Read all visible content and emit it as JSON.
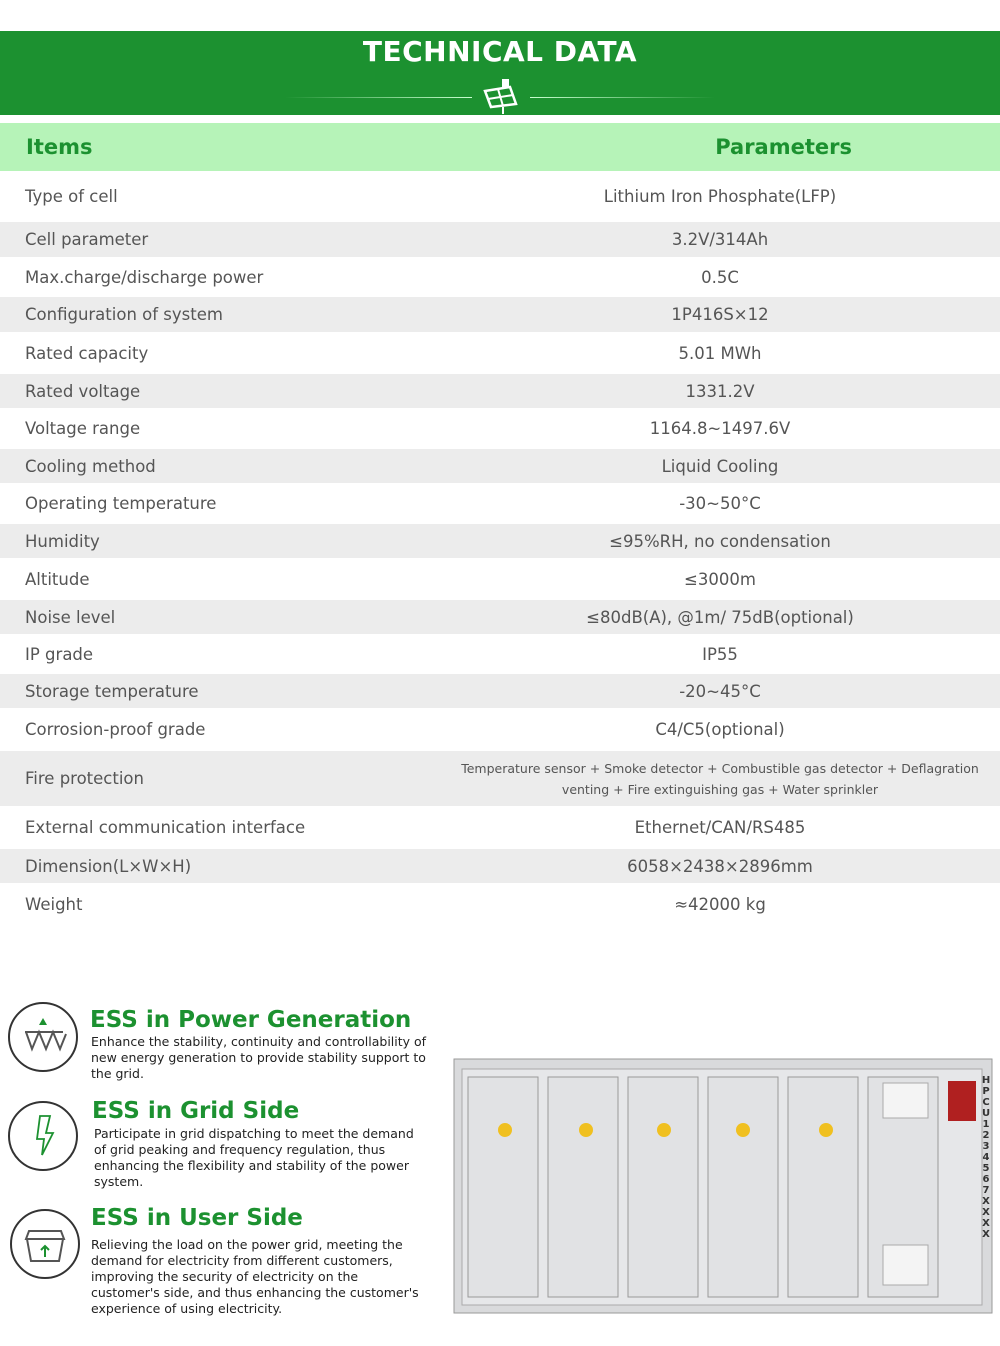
{
  "header": {
    "title": "TECHNICAL DATA"
  },
  "table": {
    "col_items": "Items",
    "col_params": "Parameters",
    "rows": [
      {
        "item": "Type of cell",
        "value": "Lithium Iron Phosphate(LFP)"
      },
      {
        "item": "Cell parameter",
        "value": "3.2V/314Ah"
      },
      {
        "item": "Max.charge/discharge power",
        "value": "0.5C"
      },
      {
        "item": "Configuration of system",
        "value": "1P416S×12"
      },
      {
        "item": "Rated capacity",
        "value": "5.01 MWh"
      },
      {
        "item": "Rated voltage",
        "value": "1331.2V"
      },
      {
        "item": "Voltage range",
        "value": "1164.8~1497.6V"
      },
      {
        "item": "Cooling method",
        "value": "Liquid Cooling"
      },
      {
        "item": "Operating temperature",
        "value": "-30~50°C"
      },
      {
        "item": "Humidity",
        "value": "≤95%RH, no condensation"
      },
      {
        "item": "Altitude",
        "value": "≤3000m"
      },
      {
        "item": "Noise level",
        "value": "≤80dB(A), @1m/ 75dB(optional)"
      },
      {
        "item": "IP grade",
        "value": "IP55"
      },
      {
        "item": "Storage temperature",
        "value": "-20~45°C"
      },
      {
        "item": "Corrosion-proof grade",
        "value": "C4/C5(optional)"
      },
      {
        "item": "Fire protection",
        "value": "Temperature sensor + Smoke detector + Combustible gas detector + Deflagration venting + Fire extinguishing gas + Water sprinkler"
      },
      {
        "item": "External communication interface",
        "value": "Ethernet/CAN/RS485"
      },
      {
        "item": "Dimension(L×W×H)",
        "value": "6058×2438×2896mm"
      },
      {
        "item": "Weight",
        "value": "≈42000 kg"
      }
    ]
  },
  "features": [
    {
      "title": "ESS in Power Generation",
      "desc": "Enhance the stability, continuity and controllability of new energy generation to provide stability support to the grid."
    },
    {
      "title": "ESS in Grid Side",
      "desc": "Participate in grid dispatching to meet the demand of grid peaking and frequency regulation, thus enhancing the flexibility and stability of the power system."
    },
    {
      "title": "ESS in User Side",
      "desc": "Relieving the load on the power grid, meeting the demand for electricity from different customers, improving the security of electricity on the customer's side, and thus enhancing the customer's experience of using electricity."
    }
  ],
  "product_label": "HPCU 1234567 XXXX",
  "colors": {
    "green": "#1c9130",
    "header_bg": "#b6f3b8",
    "row_alt": "#ececec"
  }
}
